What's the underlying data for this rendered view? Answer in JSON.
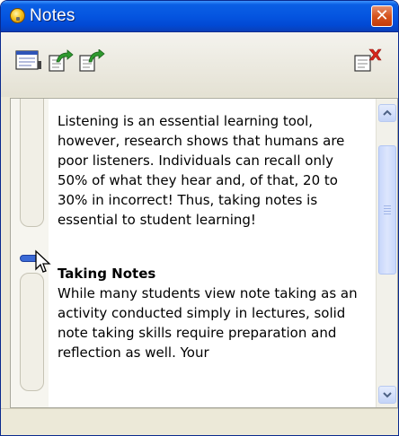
{
  "window": {
    "title": "Notes",
    "close_symbol": "✕"
  },
  "toolbar": {
    "buttons": [
      {
        "name": "notes-view-icon"
      },
      {
        "name": "note-export-icon"
      },
      {
        "name": "note-import-icon"
      },
      {
        "name": "note-delete-icon"
      }
    ]
  },
  "note": {
    "paragraph1": "Listening is an essential learning tool, however, research shows that humans are poor listeners. Individuals can recall only 50% of what they hear and, of that, 20 to 30% in incorrect! Thus, taking notes is essential to student learning!",
    "heading": "Taking Notes",
    "paragraph2": "While many students view note taking as an activity conducted simply in lectures, solid note taking skills require preparation and reflection as well. Your"
  },
  "scrollbar": {
    "position_fraction": 0.0
  },
  "colors": {
    "titlebar": "#0555e0",
    "close": "#d6541e",
    "thumb": "#c8d7fb",
    "handle": "#3b6ad6"
  }
}
